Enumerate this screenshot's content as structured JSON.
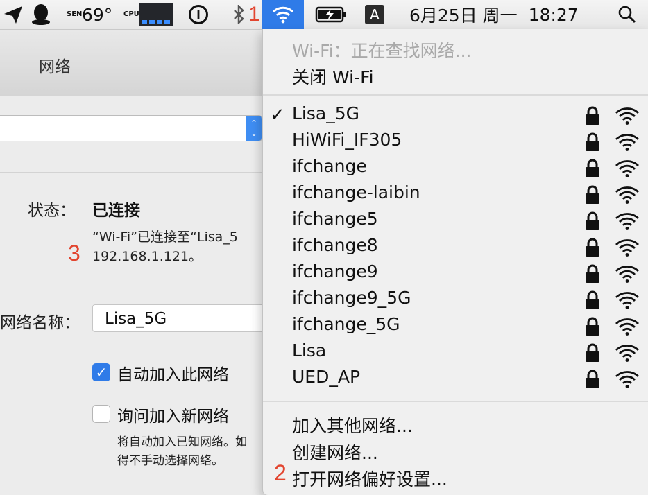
{
  "menubar": {
    "sensor_label": "SEN",
    "temperature": "69°",
    "cpu_label": "CPU",
    "info_icon_glyph": "i",
    "input_method": "A",
    "date": "6月25日 周一",
    "time": "18:27",
    "icons": [
      "send-icon",
      "qq-penguin-icon",
      "cpu-meter-icon",
      "info-icon",
      "bluetooth-icon",
      "wifi-icon",
      "battery-charging-icon",
      "input-source-icon",
      "spotlight-search-icon"
    ]
  },
  "window": {
    "title": "网络",
    "status_label": "状态：",
    "status_value": "已连接",
    "status_desc_line1": "“Wi-Fi”已连接至“Lisa_5",
    "status_desc_line2": "192.168.1.121。",
    "network_name_label": "网络名称：",
    "network_name_value": "Lisa_5G",
    "auto_join_label": "自动加入此网络",
    "auto_join_checked": true,
    "ask_join_label": "询问加入新网络",
    "ask_join_checked": false,
    "hint_line1": "将自动加入已知网络。如",
    "hint_line2": "得不手动选择网络。"
  },
  "wifi_menu": {
    "status_text": "Wi-Fi：正在查找网络...",
    "turn_off": "关闭 Wi-Fi",
    "connected_network": "Lisa_5G",
    "networks": [
      {
        "ssid": "Lisa_5G",
        "connected": true,
        "secured": true
      },
      {
        "ssid": "HiWiFi_IF305",
        "connected": false,
        "secured": true
      },
      {
        "ssid": "ifchange",
        "connected": false,
        "secured": true
      },
      {
        "ssid": "ifchange-laibin",
        "connected": false,
        "secured": true
      },
      {
        "ssid": "ifchange5",
        "connected": false,
        "secured": true
      },
      {
        "ssid": "ifchange8",
        "connected": false,
        "secured": true
      },
      {
        "ssid": "ifchange9",
        "connected": false,
        "secured": true
      },
      {
        "ssid": "ifchange9_5G",
        "connected": false,
        "secured": true
      },
      {
        "ssid": "ifchange_5G",
        "connected": false,
        "secured": true
      },
      {
        "ssid": "Lisa",
        "connected": false,
        "secured": true
      },
      {
        "ssid": "UED_AP",
        "connected": false,
        "secured": true
      }
    ],
    "join_other": "加入其他网络...",
    "create_network": "创建网络...",
    "open_prefs": "打开网络偏好设置..."
  },
  "annotations": {
    "n1": "1",
    "n2": "2",
    "n3": "3"
  },
  "colors": {
    "accent": "#2f7be8",
    "annotation": "#e2452f",
    "disabled_text": "#a9a9a9"
  }
}
